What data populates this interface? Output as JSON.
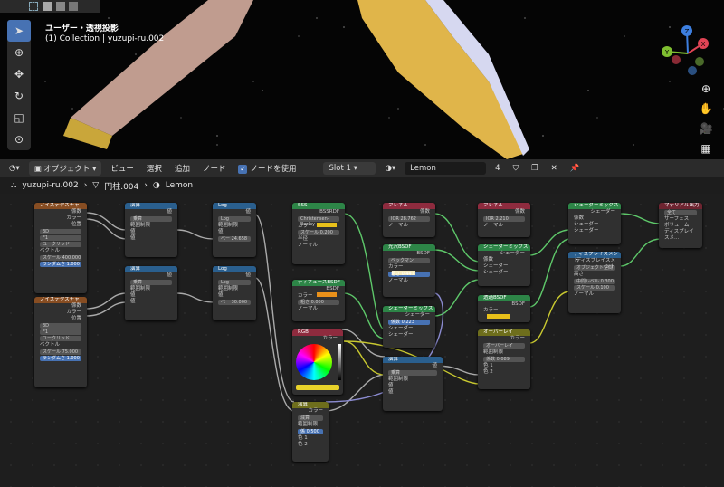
{
  "viewport": {
    "view_name": "ユーザー・透視投影",
    "collection": "(1) Collection | yuzupi-ru.002",
    "gizmo_labels": [
      "X",
      "Y",
      "Z"
    ]
  },
  "header": {
    "mode_label": "オブジェクト",
    "menus": [
      "ビュー",
      "選択",
      "追加",
      "ノード"
    ],
    "use_nodes_label": "ノードを使用",
    "slot_label": "Slot 1",
    "material_name": "Lemon",
    "user_count": "4"
  },
  "breadcrumb": {
    "object": "yuzupi-ru.002",
    "mesh": "円柱.004",
    "material": "Lemon"
  },
  "nodes": {
    "noise1": {
      "title": "ノイズテクスチャ",
      "out1": "係数",
      "out2": "カラー",
      "in1": "位置",
      "dim": "3D",
      "mode": "F1",
      "metric": "ユークリッド",
      "vec": "ベクトル",
      "scale": "スケール  400.000",
      "rand": "ランダムさ  1.000"
    },
    "noise2": {
      "title": "ノイズテクスチャ",
      "out1": "係数",
      "out2": "カラー",
      "in1": "位置",
      "dim": "3D",
      "mode": "F1",
      "metric": "ユークリッド",
      "vec": "ベクトル",
      "scale": "スケール  75.000",
      "rand": "ランダムさ  1.000"
    },
    "math1": {
      "title": "演算",
      "out": "値",
      "op": "乗算",
      "clamp": "範囲制限",
      "v1": "値",
      "v2": "値"
    },
    "math2": {
      "title": "演算",
      "out": "値",
      "op": "乗算",
      "clamp": "範囲制限",
      "v1": "値",
      "v2": "値"
    },
    "log1": {
      "title": "Log",
      "out": "値",
      "op": "Log",
      "clamp": "範囲制限",
      "v1": "値",
      "base": "ベー  24.658"
    },
    "log2": {
      "title": "Log",
      "out": "値",
      "op": "Log",
      "clamp": "範囲制限",
      "v1": "値",
      "base": "ベー  30.000"
    },
    "sss": {
      "title": "SSS",
      "out": "BSSRDF",
      "method": "Christensen-Burley",
      "color": "カラー",
      "scale": "スケール  0.200",
      "radius": "半径",
      "normal": "ノーマル"
    },
    "diffuse": {
      "title": "ディフューズBSDF",
      "out": "BSDF",
      "color": "カラー",
      "rough": "粗さ  0.000",
      "normal": "ノーマル"
    },
    "rgb": {
      "title": "RGB",
      "out": "カラー"
    },
    "mathBottom": {
      "title": "演算",
      "out": "カラー",
      "op": "減算",
      "clamp": "範囲制限",
      "fac": "係  0.500",
      "c1": "色 1",
      "c2": "色 2"
    },
    "fresnel1": {
      "title": "フレネル",
      "out": "係数",
      "ior": "IOR  28.762",
      "normal": "ノーマル"
    },
    "glossy": {
      "title": "光沢BSDF",
      "out": "BSDF",
      "dist": "ベックマン",
      "color": "カラー",
      "rough": "粗さ  0.447",
      "normal": "ノーマル"
    },
    "mix1": {
      "title": "シェーダーミックス",
      "out": "シェーダー",
      "fac": "係数  0.223",
      "s1": "シェーダー",
      "s2": "シェーダー"
    },
    "math3": {
      "title": "演算",
      "out": "値",
      "op": "乗算",
      "clamp": "範囲制限",
      "v1": "値",
      "v2": "値"
    },
    "fresnel2": {
      "title": "フレネル",
      "out": "係数",
      "ior": "IOR  2.210",
      "normal": "ノーマル"
    },
    "mix2": {
      "title": "シェーダーミックス",
      "out": "シェーダー",
      "fac": "係数",
      "s1": "シェーダー",
      "s2": "シェーダー"
    },
    "transp": {
      "title": "透過BSDF",
      "out": "BSDF",
      "color": "カラー"
    },
    "overlay": {
      "title": "オーバーレイ",
      "out": "カラー",
      "mode": "オーバーレイ",
      "clamp": "範囲制限",
      "fac": "係数  0.089",
      "c1": "色 1",
      "c2": "色 2"
    },
    "mix3": {
      "title": "シェーダーミックス",
      "out": "シェーダー",
      "fac": "係数",
      "s1": "シェーダー",
      "s2": "シェーダー"
    },
    "disp": {
      "title": "ディスプレイスメント",
      "out": "ディスプレイスメント",
      "space": "オブジェクト空間",
      "height": "高さ",
      "mid": "中間レベル  0.300",
      "scale": "スケール  0.100",
      "normal": "ノーマル"
    },
    "output": {
      "title": "マテリアル出力",
      "target": "全て",
      "surface": "サーフェス",
      "volume": "ボリューム",
      "disp": "ディスプレイスメ..."
    }
  },
  "colors": {
    "accent": "#4772b3",
    "rgb_swatch": "#e8d22a",
    "orange": "#e8901a",
    "cream": "#f5ecc0",
    "yellow": "#e8c01a"
  }
}
